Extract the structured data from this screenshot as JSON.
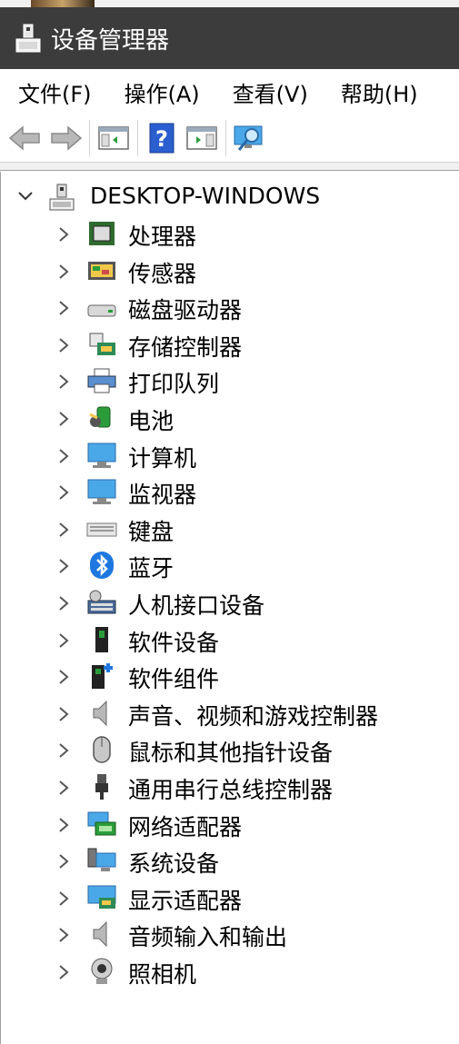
{
  "window": {
    "title": "设备管理器"
  },
  "menu": [
    {
      "label": "文件(F)"
    },
    {
      "label": "操作(A)"
    },
    {
      "label": "查看(V)"
    },
    {
      "label": "帮助(H)"
    }
  ],
  "toolbar": {
    "buttons": [
      {
        "icon": "back-arrow-icon"
      },
      {
        "icon": "forward-arrow-icon"
      },
      {
        "icon": "show-hide-console-tree-icon"
      },
      {
        "icon": "help-icon"
      },
      {
        "icon": "action-pane-icon"
      },
      {
        "icon": "scan-hardware-changes-icon"
      }
    ]
  },
  "tree": {
    "root": {
      "label": "DESKTOP-WINDOWS",
      "icon": "computer-network-icon",
      "expanded": true
    },
    "items": [
      {
        "label": "处理器",
        "icon": "processor-icon"
      },
      {
        "label": "传感器",
        "icon": "sensor-icon"
      },
      {
        "label": "磁盘驱动器",
        "icon": "disk-drive-icon"
      },
      {
        "label": "存储控制器",
        "icon": "storage-controller-icon"
      },
      {
        "label": "打印队列",
        "icon": "printer-icon"
      },
      {
        "label": "电池",
        "icon": "battery-icon"
      },
      {
        "label": "计算机",
        "icon": "computer-icon"
      },
      {
        "label": "监视器",
        "icon": "monitor-icon"
      },
      {
        "label": "键盘",
        "icon": "keyboard-icon"
      },
      {
        "label": "蓝牙",
        "icon": "bluetooth-icon"
      },
      {
        "label": "人机接口设备",
        "icon": "hid-icon"
      },
      {
        "label": "软件设备",
        "icon": "software-device-icon"
      },
      {
        "label": "软件组件",
        "icon": "software-component-icon"
      },
      {
        "label": "声音、视频和游戏控制器",
        "icon": "speaker-icon"
      },
      {
        "label": "鼠标和其他指针设备",
        "icon": "mouse-icon"
      },
      {
        "label": "通用串行总线控制器",
        "icon": "usb-icon"
      },
      {
        "label": "网络适配器",
        "icon": "network-adapter-icon"
      },
      {
        "label": "系统设备",
        "icon": "system-device-icon"
      },
      {
        "label": "显示适配器",
        "icon": "display-adapter-icon"
      },
      {
        "label": "音频输入和输出",
        "icon": "audio-io-icon"
      },
      {
        "label": "照相机",
        "icon": "camera-icon"
      }
    ]
  },
  "colors": {
    "titlebar": "#3c3c3c",
    "accent": "#1e90e0"
  }
}
